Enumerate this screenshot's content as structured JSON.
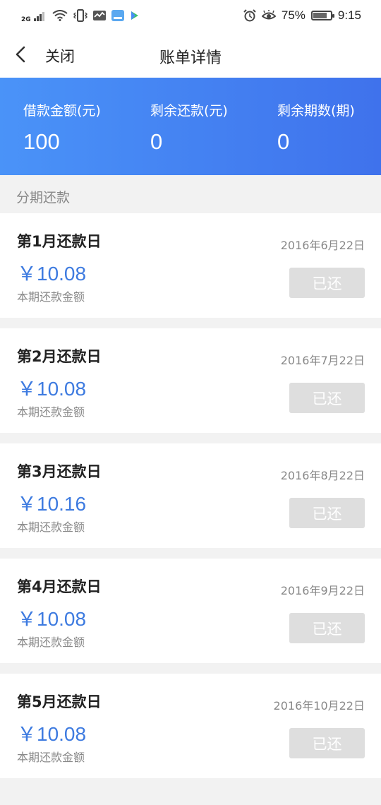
{
  "status_bar": {
    "network": "2G",
    "battery": "75%",
    "battery_level": 0.75,
    "time": "9:15"
  },
  "nav": {
    "back_label": "关闭",
    "title": "账单详情"
  },
  "summary": {
    "loan_amount_label": "借款金额(元)",
    "loan_amount": "100",
    "remaining_amount_label": "剩余还款(元)",
    "remaining_amount": "0",
    "remaining_periods_label": "剩余期数(期)",
    "remaining_periods": "0"
  },
  "section": {
    "title": "分期还款"
  },
  "installments": [
    {
      "title": "第1月还款日",
      "date": "2016年6月22日",
      "amount": "￥10.08",
      "amount_label": "本期还款金额",
      "status": "已还"
    },
    {
      "title": "第2月还款日",
      "date": "2016年7月22日",
      "amount": "￥10.08",
      "amount_label": "本期还款金额",
      "status": "已还"
    },
    {
      "title": "第3月还款日",
      "date": "2016年8月22日",
      "amount": "￥10.16",
      "amount_label": "本期还款金额",
      "status": "已还"
    },
    {
      "title": "第4月还款日",
      "date": "2016年9月22日",
      "amount": "￥10.08",
      "amount_label": "本期还款金额",
      "status": "已还"
    },
    {
      "title": "第5月还款日",
      "date": "2016年10月22日",
      "amount": "￥10.08",
      "amount_label": "本期还款金额",
      "status": "已还"
    }
  ],
  "colors": {
    "accent": "#3e7be0",
    "banner_start": "#4a93f8",
    "banner_end": "#3f72ec",
    "status_button_bg": "#dedede"
  }
}
